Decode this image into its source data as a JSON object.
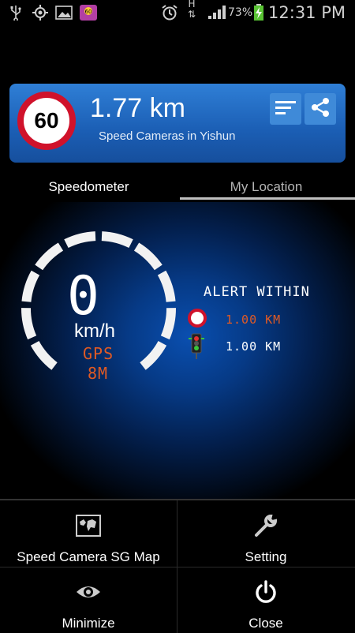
{
  "status_bar": {
    "battery_percent": "73%",
    "time": "12:31 PM",
    "network_type": "H"
  },
  "header": {
    "speed_limit": "60",
    "distance": "1.77 km",
    "subtitle": "Speed Cameras in Yishun",
    "speed_sign_color": "#d0122b"
  },
  "tabs": [
    {
      "label": "Speedometer",
      "selected": true
    },
    {
      "label": "My Location",
      "selected": false
    }
  ],
  "speedometer": {
    "speed": "0",
    "unit": "km/h",
    "gps_label": "GPS",
    "satellites": "8M",
    "accent_color": "#e05a24"
  },
  "alert": {
    "title": "ALERT WITHIN",
    "speed_camera_distance": "1.00 KM",
    "red_light_distance": "1.00 KM"
  },
  "menu": {
    "map_label": "Speed Camera SG Map",
    "setting_label": "Setting",
    "minimize_label": "Minimize",
    "close_label": "Close"
  }
}
